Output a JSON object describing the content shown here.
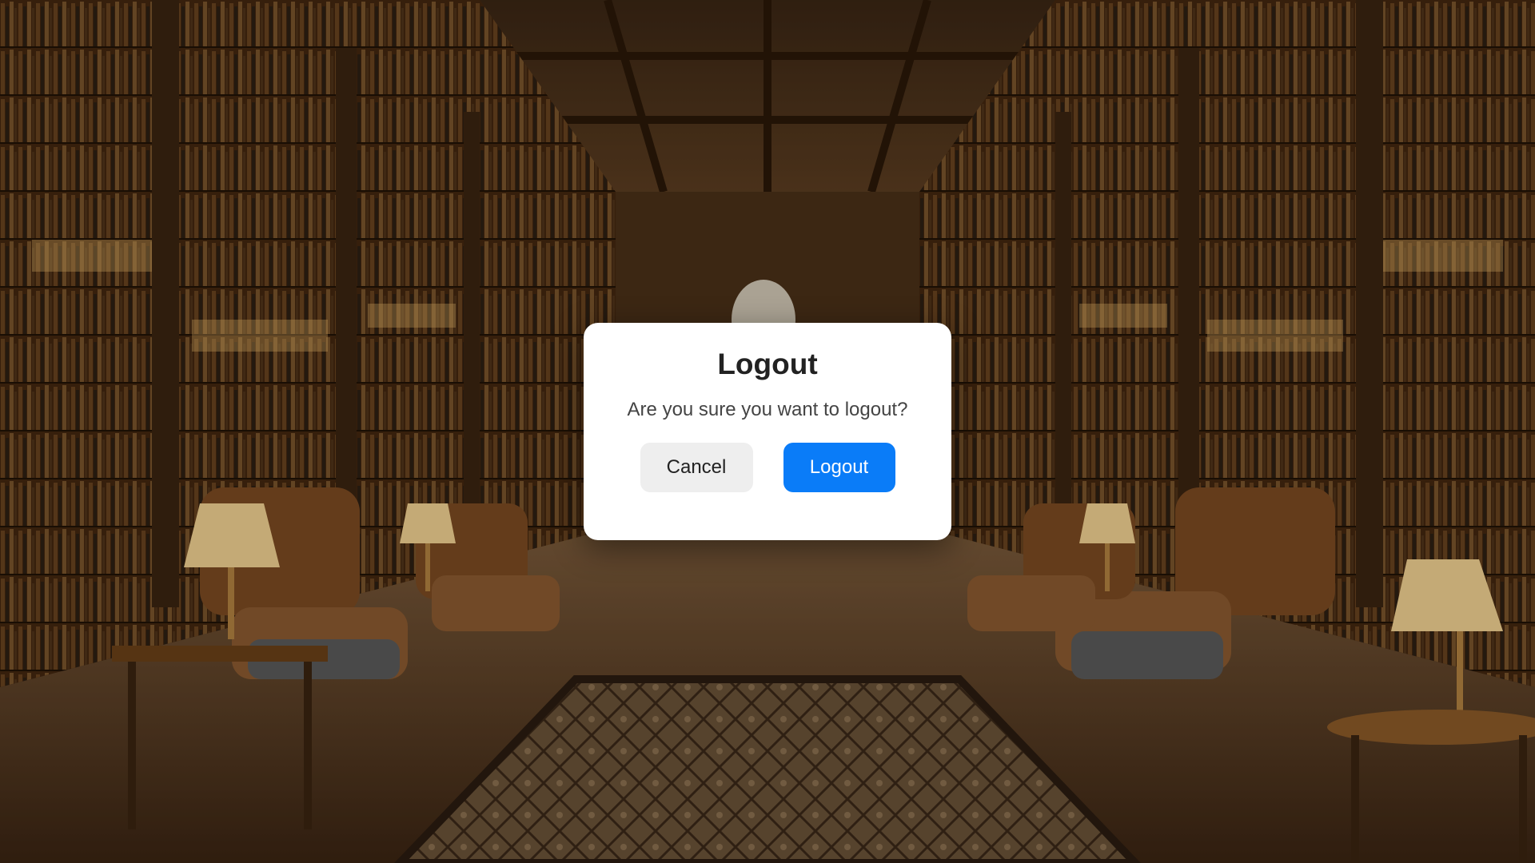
{
  "dialog": {
    "title": "Logout",
    "message": "Are you sure you want to logout?",
    "cancel_label": "Cancel",
    "confirm_label": "Logout"
  },
  "colors": {
    "confirm_button": "#0a7cf8",
    "cancel_button": "#eeeeee",
    "modal_background": "#ffffff"
  },
  "background": {
    "description_icon": "library-scene"
  }
}
